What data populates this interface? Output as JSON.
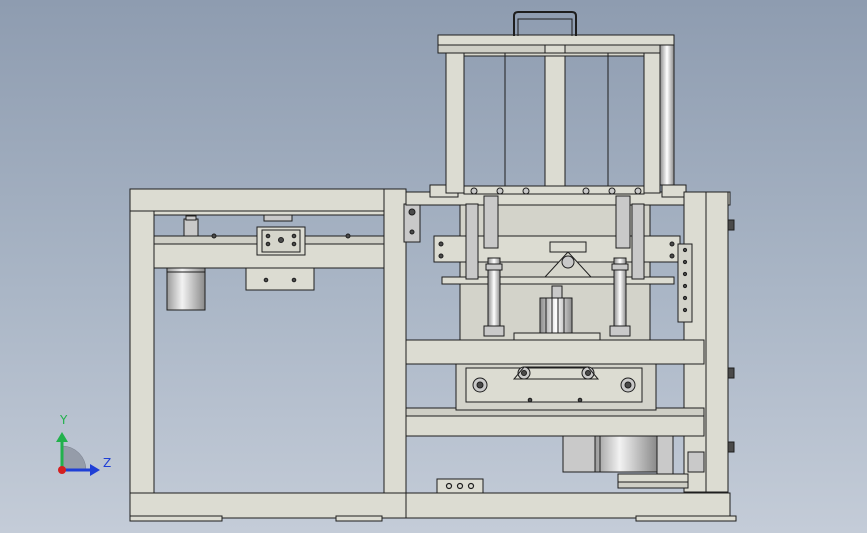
{
  "viewport": {
    "background_top": "#8e9cb0",
    "background_bottom": "#c4ccd8"
  },
  "model": {
    "frame_color": "#dcdcd2",
    "edge_color": "#1e1e1e",
    "metal_color": "#c9c9c9",
    "dark_color": "#4a4a4a"
  },
  "triad": {
    "y_label": "Y",
    "z_label": "Z",
    "y_color": "#22b14c",
    "z_color": "#1f3fd6",
    "x_color": "#d42020"
  }
}
